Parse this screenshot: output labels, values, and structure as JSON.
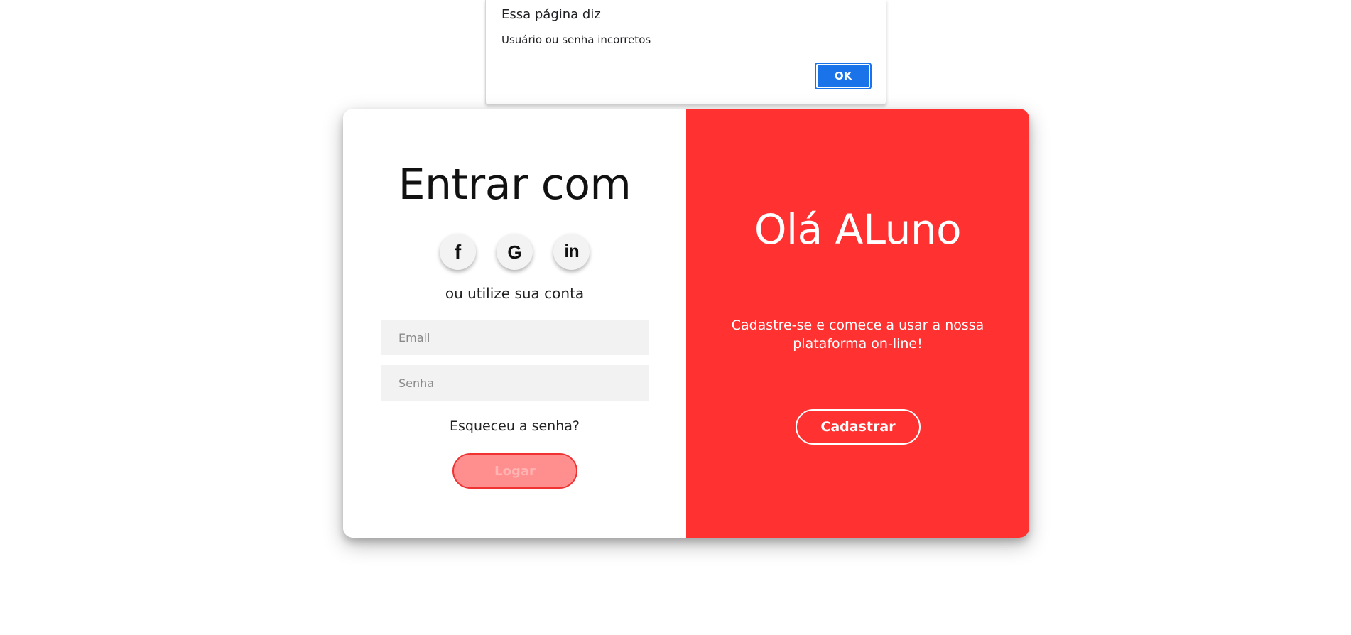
{
  "alert": {
    "title": "Essa página diz",
    "message": "Usuário ou senha incorretos",
    "ok_label": "OK",
    "accent_color": "#1a73e8"
  },
  "login": {
    "title": "Entrar com",
    "social": [
      {
        "name": "facebook",
        "icon": "facebook-icon",
        "glyph": "f"
      },
      {
        "name": "google",
        "icon": "google-icon",
        "glyph": "G"
      },
      {
        "name": "linkedin",
        "icon": "linkedin-icon",
        "glyph": "in"
      }
    ],
    "alt_text": "ou utilize sua conta",
    "email_placeholder": "Email",
    "password_placeholder": "Senha",
    "forgot_label": "Esqueceu a senha?",
    "submit_label": "Logar"
  },
  "welcome": {
    "title": "Olá ALuno",
    "text": "Cadastre-se e comece a usar a nossa plataforma on-line!",
    "register_label": "Cadastrar",
    "background_color": "#ff3131"
  }
}
